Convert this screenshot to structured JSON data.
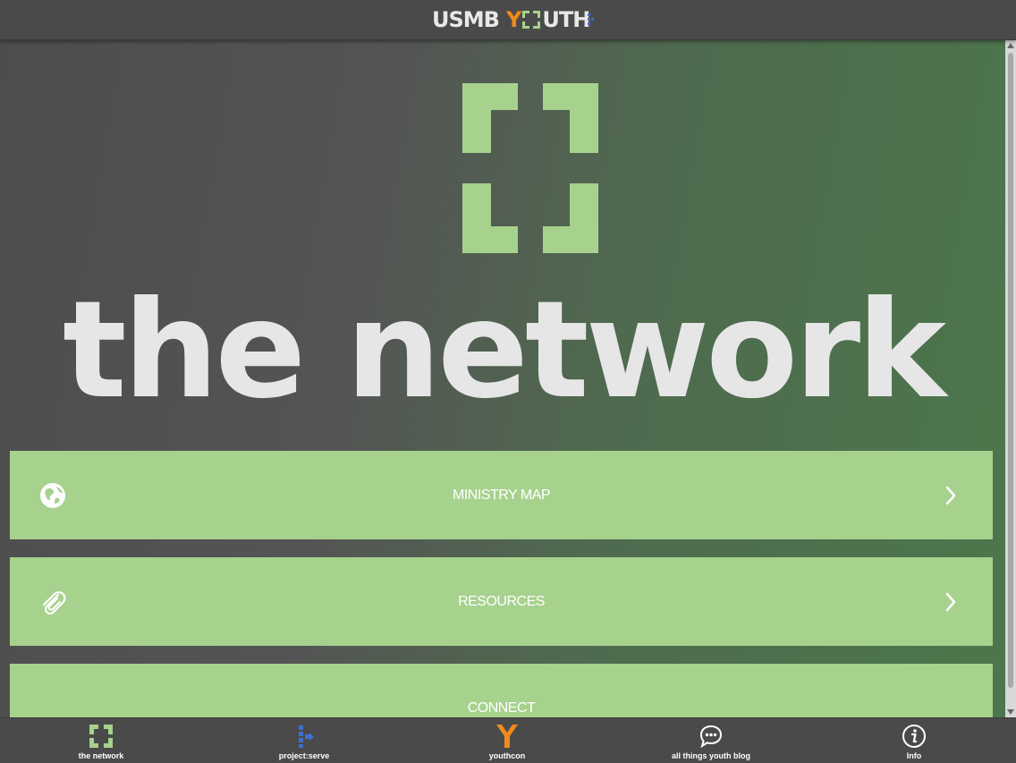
{
  "header": {
    "logo_usmb": "USMB",
    "logo_y": "Y",
    "logo_rest": "UTH"
  },
  "hero": {
    "title": "the network",
    "icon": "network-brackets-icon"
  },
  "menu": [
    {
      "label": "MINISTRY MAP",
      "icon": "globe-icon"
    },
    {
      "label": "RESOURCES",
      "icon": "paperclip-icon"
    },
    {
      "label": "CONNECT",
      "icon": ""
    }
  ],
  "tabs": [
    {
      "label": "the network",
      "icon": "network-brackets-icon"
    },
    {
      "label": "project:serve",
      "icon": "project-serve-icon"
    },
    {
      "label": "youthcon",
      "icon": "youthcon-y-icon"
    },
    {
      "label": "all things youth blog",
      "icon": "chat-bubble-icon"
    },
    {
      "label": "Info",
      "icon": "info-icon"
    }
  ],
  "colors": {
    "accent_green": "#a6d28d",
    "youth_orange": "#f08a1c",
    "serve_blue": "#3f6fd0",
    "bar_gray": "#4a4a4a"
  }
}
